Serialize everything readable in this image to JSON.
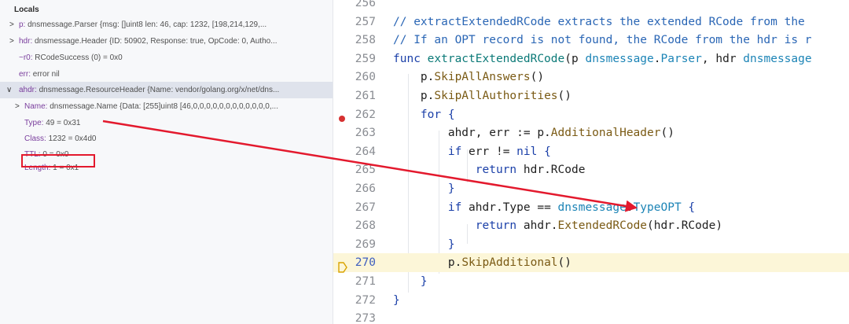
{
  "variables": {
    "rows": [
      {
        "toggle": "",
        "name": "Locals",
        "value": ""
      },
      {
        "toggle": ">",
        "name": "p:",
        "value": "dnsmessage.Parser {msg: []uint8 len: 46, cap: 1232, [198,214,129,..."
      },
      {
        "toggle": ">",
        "name": "hdr:",
        "value": "dnsmessage.Header {ID: 50902, Response: true, OpCode: 0, Autho..."
      },
      {
        "toggle": "",
        "name": "~r0:",
        "value": "RCodeSuccess (0) = 0x0"
      },
      {
        "toggle": "",
        "name": "err:",
        "value": "error nil"
      },
      {
        "toggle": "∨",
        "name": "ahdr:",
        "value": "dnsmessage.ResourceHeader {Name: vendor/golang.org/x/net/dns..."
      },
      {
        "toggle": ">",
        "name": "Name:",
        "value": "dnsmessage.Name {Data: [255]uint8 [46,0,0,0,0,0,0,0,0,0,0,0,0,..."
      },
      {
        "toggle": "",
        "name": "Type:",
        "value": "49 = 0x31"
      },
      {
        "toggle": "",
        "name": "Class:",
        "value": "1232 = 0x4d0"
      },
      {
        "toggle": "",
        "name": "TTL:",
        "value": "0 = 0x0"
      },
      {
        "toggle": "",
        "name": "Length:",
        "value": "1 = 0x1"
      }
    ]
  },
  "editor": {
    "line_numbers": [
      "256",
      "257",
      "258",
      "259",
      "260",
      "261",
      "262",
      "263",
      "264",
      "265",
      "266",
      "267",
      "268",
      "269",
      "270",
      "271",
      "272",
      "273"
    ],
    "lines": [
      [],
      [
        {
          "t": "// extractExtendedRCode extracts the extended RCode from the ",
          "c": "cm"
        }
      ],
      [
        {
          "t": "// If an OPT record is not found, the RCode from the hdr is r",
          "c": "cm"
        }
      ],
      [
        {
          "t": "func ",
          "c": "kw"
        },
        {
          "t": "extractExtendedRCode",
          "c": "fn"
        },
        {
          "t": "(p ",
          "c": "tx"
        },
        {
          "t": "dnsmessage",
          "c": "pk"
        },
        {
          "t": ".",
          "c": "tx"
        },
        {
          "t": "Parser",
          "c": "pk"
        },
        {
          "t": ", hdr ",
          "c": "tx"
        },
        {
          "t": "dnsmessage",
          "c": "pk"
        }
      ],
      [
        {
          "t": "    p.",
          "c": "tx"
        },
        {
          "t": "SkipAllAnswers",
          "c": "mt"
        },
        {
          "t": "()",
          "c": "tx"
        }
      ],
      [
        {
          "t": "    p.",
          "c": "tx"
        },
        {
          "t": "SkipAllAuthorities",
          "c": "mt"
        },
        {
          "t": "()",
          "c": "tx"
        }
      ],
      [
        {
          "t": "    ",
          "c": "tx"
        },
        {
          "t": "for",
          "c": "kw"
        },
        {
          "t": " {",
          "c": "br"
        }
      ],
      [
        {
          "t": "        ahdr, err := p.",
          "c": "tx"
        },
        {
          "t": "AdditionalHeader",
          "c": "mt"
        },
        {
          "t": "()",
          "c": "tx"
        }
      ],
      [
        {
          "t": "        ",
          "c": "tx"
        },
        {
          "t": "if",
          "c": "kw"
        },
        {
          "t": " err != ",
          "c": "tx"
        },
        {
          "t": "nil",
          "c": "kw"
        },
        {
          "t": " {",
          "c": "br"
        }
      ],
      [
        {
          "t": "            ",
          "c": "tx"
        },
        {
          "t": "return",
          "c": "kw"
        },
        {
          "t": " hdr.RCode",
          "c": "tx"
        }
      ],
      [
        {
          "t": "        }",
          "c": "br"
        }
      ],
      [
        {
          "t": "        ",
          "c": "tx"
        },
        {
          "t": "if",
          "c": "kw"
        },
        {
          "t": " ahdr.Type == ",
          "c": "tx"
        },
        {
          "t": "dnsmessage",
          "c": "pk"
        },
        {
          "t": ".",
          "c": "tx"
        },
        {
          "t": "TypeOPT",
          "c": "pk"
        },
        {
          "t": " {",
          "c": "br"
        }
      ],
      [
        {
          "t": "            ",
          "c": "tx"
        },
        {
          "t": "return",
          "c": "kw"
        },
        {
          "t": " ahdr.",
          "c": "tx"
        },
        {
          "t": "ExtendedRCode",
          "c": "mt"
        },
        {
          "t": "(hdr.RCode)",
          "c": "tx"
        }
      ],
      [
        {
          "t": "        }",
          "c": "br"
        }
      ],
      [
        {
          "t": "        p.",
          "c": "tx"
        },
        {
          "t": "SkipAdditional",
          "c": "mt"
        },
        {
          "t": "()",
          "c": "tx"
        }
      ],
      [
        {
          "t": "    }",
          "c": "br"
        }
      ],
      [
        {
          "t": "}",
          "c": "br"
        }
      ],
      []
    ],
    "breakpoint_line": "262",
    "current_line": "270"
  },
  "colors": {
    "annotation_red": "#e3192d",
    "breakpoint_red": "#d63131",
    "current_line_bg": "#fcf6d8",
    "comment_blue": "#2a66b5"
  },
  "icons": {
    "breakpoint": "breakpoint-dot-icon",
    "execution_point": "execution-arrow-icon",
    "expand": "chevron-right-icon",
    "collapse": "chevron-down-icon"
  }
}
